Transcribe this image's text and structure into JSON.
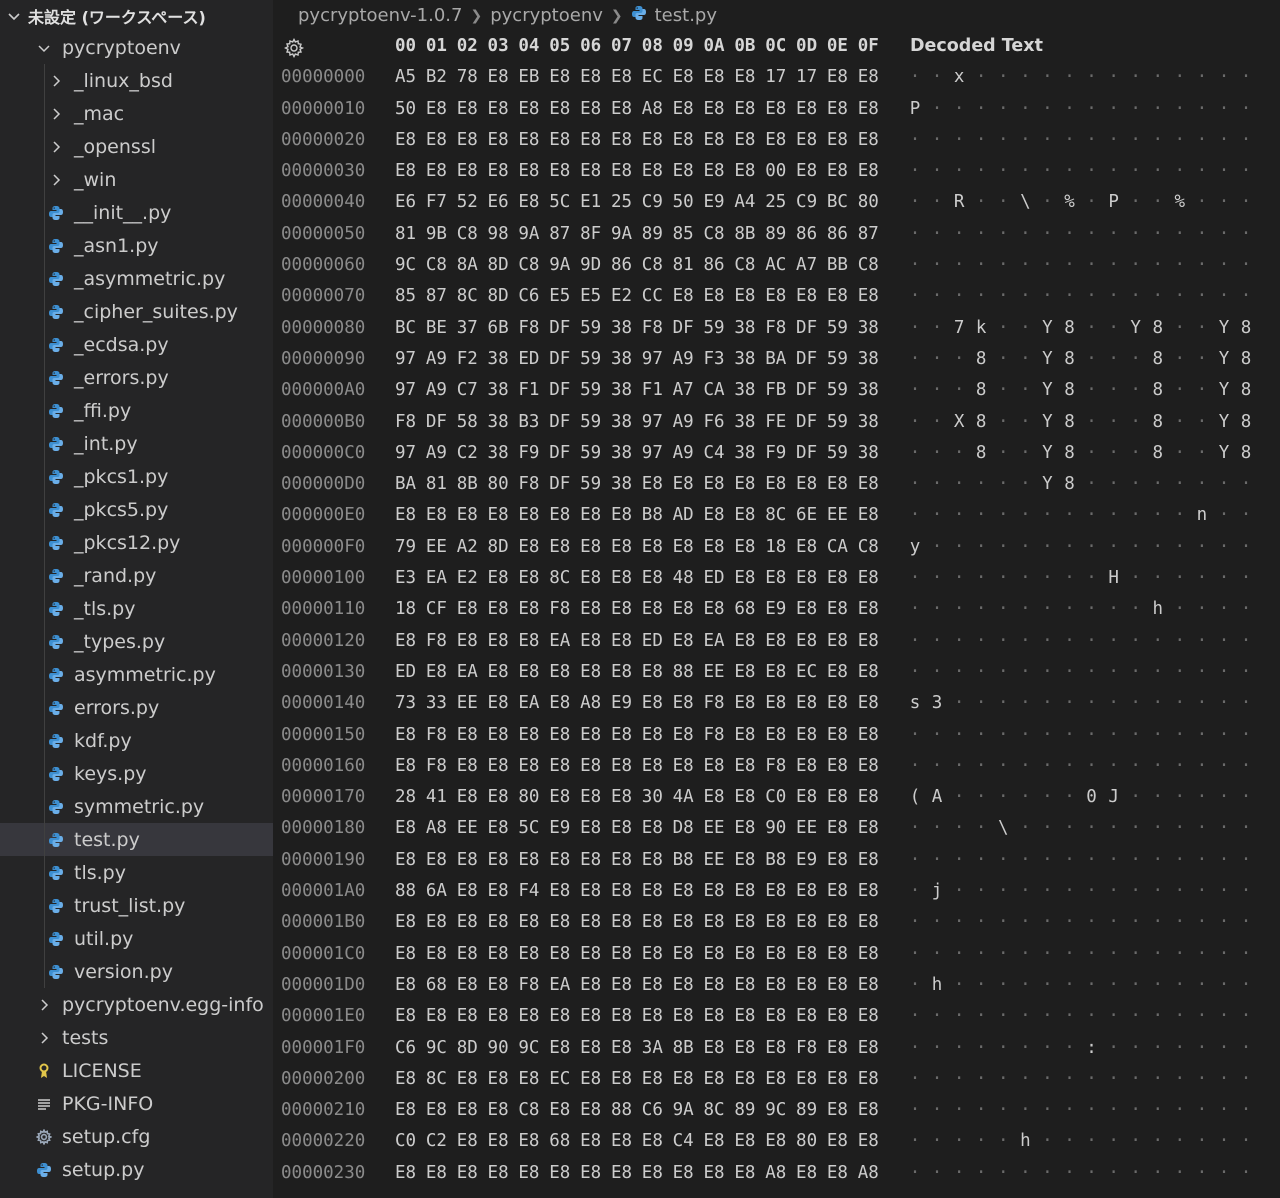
{
  "explorer": {
    "workspace_title": "未設定 (ワークスペース)",
    "items": [
      {
        "label": "pycryptoenv",
        "depth": 1,
        "type": "folder-open"
      },
      {
        "label": "_linux_bsd",
        "depth": 2,
        "type": "folder"
      },
      {
        "label": "_mac",
        "depth": 2,
        "type": "folder"
      },
      {
        "label": "_openssl",
        "depth": 2,
        "type": "folder"
      },
      {
        "label": "_win",
        "depth": 2,
        "type": "folder"
      },
      {
        "label": "__init__.py",
        "depth": 2,
        "type": "python"
      },
      {
        "label": "_asn1.py",
        "depth": 2,
        "type": "python"
      },
      {
        "label": "_asymmetric.py",
        "depth": 2,
        "type": "python"
      },
      {
        "label": "_cipher_suites.py",
        "depth": 2,
        "type": "python"
      },
      {
        "label": "_ecdsa.py",
        "depth": 2,
        "type": "python"
      },
      {
        "label": "_errors.py",
        "depth": 2,
        "type": "python"
      },
      {
        "label": "_ffi.py",
        "depth": 2,
        "type": "python"
      },
      {
        "label": "_int.py",
        "depth": 2,
        "type": "python"
      },
      {
        "label": "_pkcs1.py",
        "depth": 2,
        "type": "python"
      },
      {
        "label": "_pkcs5.py",
        "depth": 2,
        "type": "python"
      },
      {
        "label": "_pkcs12.py",
        "depth": 2,
        "type": "python"
      },
      {
        "label": "_rand.py",
        "depth": 2,
        "type": "python"
      },
      {
        "label": "_tls.py",
        "depth": 2,
        "type": "python"
      },
      {
        "label": "_types.py",
        "depth": 2,
        "type": "python"
      },
      {
        "label": "asymmetric.py",
        "depth": 2,
        "type": "python"
      },
      {
        "label": "errors.py",
        "depth": 2,
        "type": "python"
      },
      {
        "label": "kdf.py",
        "depth": 2,
        "type": "python"
      },
      {
        "label": "keys.py",
        "depth": 2,
        "type": "python"
      },
      {
        "label": "symmetric.py",
        "depth": 2,
        "type": "python"
      },
      {
        "label": "test.py",
        "depth": 2,
        "type": "python",
        "selected": true
      },
      {
        "label": "tls.py",
        "depth": 2,
        "type": "python"
      },
      {
        "label": "trust_list.py",
        "depth": 2,
        "type": "python"
      },
      {
        "label": "util.py",
        "depth": 2,
        "type": "python"
      },
      {
        "label": "version.py",
        "depth": 2,
        "type": "python"
      },
      {
        "label": "pycryptoenv.egg-info",
        "depth": 1,
        "type": "folder"
      },
      {
        "label": "tests",
        "depth": 1,
        "type": "folder"
      },
      {
        "label": "LICENSE",
        "depth": 1,
        "type": "license"
      },
      {
        "label": "PKG-INFO",
        "depth": 1,
        "type": "info"
      },
      {
        "label": "setup.cfg",
        "depth": 1,
        "type": "gear"
      },
      {
        "label": "setup.py",
        "depth": 1,
        "type": "python"
      }
    ]
  },
  "breadcrumb": [
    "pycryptoenv-1.0.7",
    "pycryptoenv",
    "test.py"
  ],
  "hex_editor": {
    "column_headers": [
      "00",
      "01",
      "02",
      "03",
      "04",
      "05",
      "06",
      "07",
      "08",
      "09",
      "0A",
      "0B",
      "0C",
      "0D",
      "0E",
      "0F"
    ],
    "decoded_title": "Decoded Text",
    "rows": [
      {
        "addr": "00000000",
        "bytes": "A5 B2 78 E8 EB E8 E8 E8 EC E8 E8 E8 17 17 E8 E8",
        "decoded": [
          "",
          "",
          "x",
          "",
          "",
          "",
          "",
          "",
          "",
          "",
          "",
          "",
          "",
          "",
          "",
          ""
        ]
      },
      {
        "addr": "00000010",
        "bytes": "50 E8 E8 E8 E8 E8 E8 E8 A8 E8 E8 E8 E8 E8 E8 E8",
        "decoded": [
          "P",
          "",
          "",
          "",
          "",
          "",
          "",
          "",
          "",
          "",
          "",
          "",
          "",
          "",
          "",
          ""
        ]
      },
      {
        "addr": "00000020",
        "bytes": "E8 E8 E8 E8 E8 E8 E8 E8 E8 E8 E8 E8 E8 E8 E8 E8",
        "decoded": [
          "",
          "",
          "",
          "",
          "",
          "",
          "",
          "",
          "",
          "",
          "",
          "",
          "",
          "",
          "",
          ""
        ]
      },
      {
        "addr": "00000030",
        "bytes": "E8 E8 E8 E8 E8 E8 E8 E8 E8 E8 E8 E8 00 E8 E8 E8",
        "decoded": [
          "",
          "",
          "",
          "",
          "",
          "",
          "",
          "",
          "",
          "",
          "",
          "",
          "",
          "",
          "",
          ""
        ]
      },
      {
        "addr": "00000040",
        "bytes": "E6 F7 52 E6 E8 5C E1 25 C9 50 E9 A4 25 C9 BC 80",
        "decoded": [
          "",
          "",
          "R",
          "",
          "",
          "\\",
          "",
          "%",
          "",
          "P",
          "",
          "",
          "%",
          "",
          "",
          ""
        ]
      },
      {
        "addr": "00000050",
        "bytes": "81 9B C8 98 9A 87 8F 9A 89 85 C8 8B 89 86 86 87",
        "decoded": [
          "",
          "",
          "",
          "",
          "",
          "",
          "",
          "",
          "",
          "",
          "",
          "",
          "",
          "",
          "",
          ""
        ]
      },
      {
        "addr": "00000060",
        "bytes": "9C C8 8A 8D C8 9A 9D 86 C8 81 86 C8 AC A7 BB C8",
        "decoded": [
          "",
          "",
          "",
          "",
          "",
          "",
          "",
          "",
          "",
          "",
          "",
          "",
          "",
          "",
          "",
          ""
        ]
      },
      {
        "addr": "00000070",
        "bytes": "85 87 8C 8D C6 E5 E5 E2 CC E8 E8 E8 E8 E8 E8 E8",
        "decoded": [
          "",
          "",
          "",
          "",
          "",
          "",
          "",
          "",
          "",
          "",
          "",
          "",
          "",
          "",
          "",
          ""
        ]
      },
      {
        "addr": "00000080",
        "bytes": "BC BE 37 6B F8 DF 59 38 F8 DF 59 38 F8 DF 59 38",
        "decoded": [
          "",
          "",
          "7",
          "k",
          "",
          "",
          "Y",
          "8",
          "",
          "",
          "Y",
          "8",
          "",
          "",
          "Y",
          "8"
        ]
      },
      {
        "addr": "00000090",
        "bytes": "97 A9 F2 38 ED DF 59 38 97 A9 F3 38 BA DF 59 38",
        "decoded": [
          "",
          "",
          "",
          "8",
          "",
          "",
          "Y",
          "8",
          "",
          "",
          "",
          "8",
          "",
          "",
          "Y",
          "8"
        ]
      },
      {
        "addr": "000000A0",
        "bytes": "97 A9 C7 38 F1 DF 59 38 F1 A7 CA 38 FB DF 59 38",
        "decoded": [
          "",
          "",
          "",
          "8",
          "",
          "",
          "Y",
          "8",
          "",
          "",
          "",
          "8",
          "",
          "",
          "Y",
          "8"
        ]
      },
      {
        "addr": "000000B0",
        "bytes": "F8 DF 58 38 B3 DF 59 38 97 A9 F6 38 FE DF 59 38",
        "decoded": [
          "",
          "",
          "X",
          "8",
          "",
          "",
          "Y",
          "8",
          "",
          "",
          "",
          "8",
          "",
          "",
          "Y",
          "8"
        ]
      },
      {
        "addr": "000000C0",
        "bytes": "97 A9 C2 38 F9 DF 59 38 97 A9 C4 38 F9 DF 59 38",
        "decoded": [
          "",
          "",
          "",
          "8",
          "",
          "",
          "Y",
          "8",
          "",
          "",
          "",
          "8",
          "",
          "",
          "Y",
          "8"
        ]
      },
      {
        "addr": "000000D0",
        "bytes": "BA 81 8B 80 F8 DF 59 38 E8 E8 E8 E8 E8 E8 E8 E8",
        "decoded": [
          "",
          "",
          "",
          "",
          "",
          "",
          "Y",
          "8",
          "",
          "",
          "",
          "",
          "",
          "",
          "",
          ""
        ]
      },
      {
        "addr": "000000E0",
        "bytes": "E8 E8 E8 E8 E8 E8 E8 E8 B8 AD E8 E8 8C 6E EE E8",
        "decoded": [
          "",
          "",
          "",
          "",
          "",
          "",
          "",
          "",
          "",
          "",
          "",
          "",
          "",
          "n",
          "",
          ""
        ]
      },
      {
        "addr": "000000F0",
        "bytes": "79 EE A2 8D E8 E8 E8 E8 E8 E8 E8 E8 18 E8 CA C8",
        "decoded": [
          "y",
          "",
          "",
          "",
          "",
          "",
          "",
          "",
          "",
          "",
          "",
          "",
          "",
          "",
          "",
          ""
        ]
      },
      {
        "addr": "00000100",
        "bytes": "E3 EA E2 E8 E8 8C E8 E8 E8 48 ED E8 E8 E8 E8 E8",
        "decoded": [
          "",
          "",
          "",
          "",
          "",
          "",
          "",
          "",
          "",
          "H",
          "",
          "",
          "",
          "",
          "",
          ""
        ]
      },
      {
        "addr": "00000110",
        "bytes": "18 CF E8 E8 E8 F8 E8 E8 E8 E8 E8 68 E9 E8 E8 E8",
        "decoded": [
          "",
          "",
          "",
          "",
          "",
          "",
          "",
          "",
          "",
          "",
          "",
          "h",
          "",
          "",
          "",
          ""
        ]
      },
      {
        "addr": "00000120",
        "bytes": "E8 F8 E8 E8 E8 EA E8 E8 ED E8 EA E8 E8 E8 E8 E8",
        "decoded": [
          "",
          "",
          "",
          "",
          "",
          "",
          "",
          "",
          "",
          "",
          "",
          "",
          "",
          "",
          "",
          ""
        ]
      },
      {
        "addr": "00000130",
        "bytes": "ED E8 EA E8 E8 E8 E8 E8 E8 88 EE E8 E8 EC E8 E8",
        "decoded": [
          "",
          "",
          "",
          "",
          "",
          "",
          "",
          "",
          "",
          "",
          "",
          "",
          "",
          "",
          "",
          ""
        ]
      },
      {
        "addr": "00000140",
        "bytes": "73 33 EE E8 EA E8 A8 E9 E8 E8 F8 E8 E8 E8 E8 E8",
        "decoded": [
          "s",
          "3",
          "",
          "",
          "",
          "",
          "",
          "",
          "",
          "",
          "",
          "",
          "",
          "",
          "",
          ""
        ]
      },
      {
        "addr": "00000150",
        "bytes": "E8 F8 E8 E8 E8 E8 E8 E8 E8 E8 F8 E8 E8 E8 E8 E8",
        "decoded": [
          "",
          "",
          "",
          "",
          "",
          "",
          "",
          "",
          "",
          "",
          "",
          "",
          "",
          "",
          "",
          ""
        ]
      },
      {
        "addr": "00000160",
        "bytes": "E8 F8 E8 E8 E8 E8 E8 E8 E8 E8 E8 E8 F8 E8 E8 E8",
        "decoded": [
          "",
          "",
          "",
          "",
          "",
          "",
          "",
          "",
          "",
          "",
          "",
          "",
          "",
          "",
          "",
          ""
        ]
      },
      {
        "addr": "00000170",
        "bytes": "28 41 E8 E8 80 E8 E8 E8 30 4A E8 E8 C0 E8 E8 E8",
        "decoded": [
          "(",
          "A",
          "",
          "",
          "",
          "",
          "",
          "",
          "0",
          "J",
          "",
          "",
          "",
          "",
          "",
          ""
        ]
      },
      {
        "addr": "00000180",
        "bytes": "E8 A8 EE E8 5C E9 E8 E8 E8 D8 EE E8 90 EE E8 E8",
        "decoded": [
          "",
          "",
          "",
          "",
          "\\",
          "",
          "",
          "",
          "",
          "",
          "",
          "",
          "",
          "",
          "",
          ""
        ]
      },
      {
        "addr": "00000190",
        "bytes": "E8 E8 E8 E8 E8 E8 E8 E8 E8 B8 EE E8 B8 E9 E8 E8",
        "decoded": [
          "",
          "",
          "",
          "",
          "",
          "",
          "",
          "",
          "",
          "",
          "",
          "",
          "",
          "",
          "",
          ""
        ]
      },
      {
        "addr": "000001A0",
        "bytes": "88 6A E8 E8 F4 E8 E8 E8 E8 E8 E8 E8 E8 E8 E8 E8",
        "decoded": [
          "",
          "j",
          "",
          "",
          "",
          "",
          "",
          "",
          "",
          "",
          "",
          "",
          "",
          "",
          "",
          ""
        ]
      },
      {
        "addr": "000001B0",
        "bytes": "E8 E8 E8 E8 E8 E8 E8 E8 E8 E8 E8 E8 E8 E8 E8 E8",
        "decoded": [
          "",
          "",
          "",
          "",
          "",
          "",
          "",
          "",
          "",
          "",
          "",
          "",
          "",
          "",
          "",
          ""
        ]
      },
      {
        "addr": "000001C0",
        "bytes": "E8 E8 E8 E8 E8 E8 E8 E8 E8 E8 E8 E8 E8 E8 E8 E8",
        "decoded": [
          "",
          "",
          "",
          "",
          "",
          "",
          "",
          "",
          "",
          "",
          "",
          "",
          "",
          "",
          "",
          ""
        ]
      },
      {
        "addr": "000001D0",
        "bytes": "E8 68 E8 E8 F8 EA E8 E8 E8 E8 E8 E8 E8 E8 E8 E8",
        "decoded": [
          "",
          "h",
          "",
          "",
          "",
          "",
          "",
          "",
          "",
          "",
          "",
          "",
          "",
          "",
          "",
          ""
        ]
      },
      {
        "addr": "000001E0",
        "bytes": "E8 E8 E8 E8 E8 E8 E8 E8 E8 E8 E8 E8 E8 E8 E8 E8",
        "decoded": [
          "",
          "",
          "",
          "",
          "",
          "",
          "",
          "",
          "",
          "",
          "",
          "",
          "",
          "",
          "",
          ""
        ]
      },
      {
        "addr": "000001F0",
        "bytes": "C6 9C 8D 90 9C E8 E8 E8 3A 8B E8 E8 E8 F8 E8 E8",
        "decoded": [
          "",
          "",
          "",
          "",
          "",
          "",
          "",
          "",
          ":",
          "",
          "",
          "",
          "",
          "",
          "",
          ""
        ]
      },
      {
        "addr": "00000200",
        "bytes": "E8 8C E8 E8 E8 EC E8 E8 E8 E8 E8 E8 E8 E8 E8 E8",
        "decoded": [
          "",
          "",
          "",
          "",
          "",
          "",
          "",
          "",
          "",
          "",
          "",
          "",
          "",
          "",
          "",
          ""
        ]
      },
      {
        "addr": "00000210",
        "bytes": "E8 E8 E8 E8 C8 E8 E8 88 C6 9A 8C 89 9C 89 E8 E8",
        "decoded": [
          "",
          "",
          "",
          "",
          "",
          "",
          "",
          "",
          "",
          "",
          "",
          "",
          "",
          "",
          "",
          ""
        ]
      },
      {
        "addr": "00000220",
        "bytes": "C0 C2 E8 E8 E8 68 E8 E8 E8 C4 E8 E8 E8 80 E8 E8",
        "decoded": [
          "",
          "",
          "",
          "",
          "",
          "h",
          "",
          "",
          "",
          "",
          "",
          "",
          "",
          "",
          "",
          ""
        ]
      },
      {
        "addr": "00000230",
        "bytes": "E8 E8 E8 E8 E8 E8 E8 E8 E8 E8 E8 E8 A8 E8 E8 A8",
        "decoded": [
          "",
          "",
          "",
          "",
          "",
          "",
          "",
          "",
          "",
          "",
          "",
          "",
          "",
          "",
          "",
          ""
        ]
      }
    ]
  },
  "icons": {
    "python_color": "#3d8fd1",
    "license_color": "#e2c64a",
    "accent": "#37373d"
  }
}
